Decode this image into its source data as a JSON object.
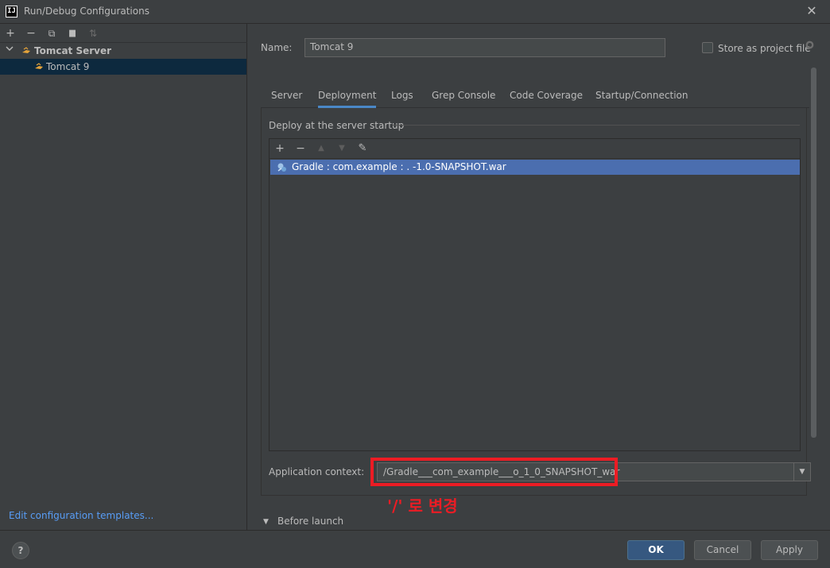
{
  "window": {
    "title": "Run/Debug Configurations",
    "app_icon_text": "IJ",
    "close_glyph": "✕"
  },
  "left_toolbar": {
    "add": "+",
    "remove": "−",
    "copy": "⧉",
    "folder": "▆",
    "sort": "⇅"
  },
  "tree": {
    "group_label": "Tomcat Server",
    "item_label": "Tomcat 9"
  },
  "edit_templates_link": "Edit configuration templates...",
  "name_field": {
    "label": "Name:",
    "value": "Tomcat 9"
  },
  "store_as_project_file": {
    "label": "Store as project file",
    "checked": false
  },
  "tabs": [
    {
      "label": "Server",
      "active": false
    },
    {
      "label": "Deployment",
      "active": true
    },
    {
      "label": "Logs",
      "active": false
    },
    {
      "label": "Grep Console",
      "active": false
    },
    {
      "label": "Code Coverage",
      "active": false
    },
    {
      "label": "Startup/Connection",
      "active": false
    }
  ],
  "deploy_section": {
    "title": "Deploy at the server startup",
    "toolbar": {
      "add": "+",
      "remove": "−",
      "up": "▲",
      "down": "▼",
      "edit": "✎"
    },
    "items": [
      {
        "text": "Gradle : com.example :     .  -1.0-SNAPSHOT.war",
        "selected": true
      }
    ]
  },
  "application_context": {
    "label": "Application context:",
    "value": "/Gradle___com_example___o_1_0_SNAPSHOT_war"
  },
  "annotation": {
    "note": "'/' 로 변경",
    "color": "#ec1c24"
  },
  "before_launch": {
    "label": "Before launch",
    "expanded": true
  },
  "buttons": {
    "help": "?",
    "ok": "OK",
    "cancel": "Cancel",
    "apply": "Apply"
  },
  "colors": {
    "background": "#3c3f41",
    "selection": "#4b6eaf",
    "tree_selection": "#0d293e",
    "link": "#589df6",
    "primary_button": "#365880",
    "tab_underline": "#4a88c7"
  }
}
